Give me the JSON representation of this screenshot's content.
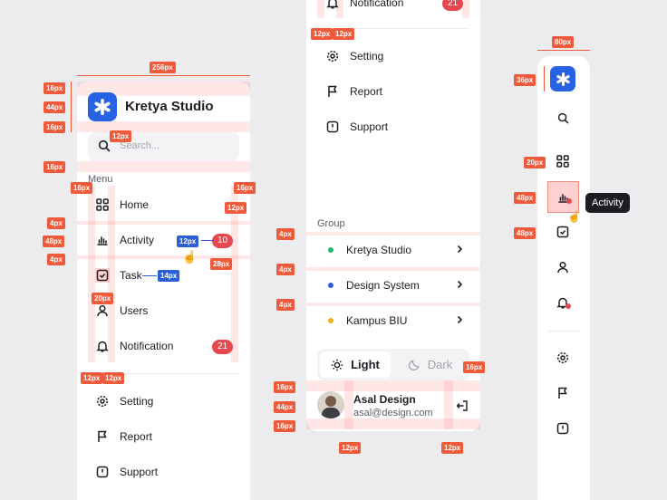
{
  "brand": {
    "name": "Kretya Studio"
  },
  "search": {
    "placeholder": "Search..."
  },
  "menu": {
    "heading": "Menu",
    "items": [
      {
        "label": "Home",
        "icon": "grid-icon"
      },
      {
        "label": "Activity",
        "icon": "chart-bars-icon"
      },
      {
        "label": "Task",
        "icon": "checkbox-icon"
      },
      {
        "label": "Users",
        "icon": "user-icon"
      },
      {
        "label": "Notification",
        "icon": "bell-icon",
        "badge": "21"
      }
    ],
    "activity_badge": "10"
  },
  "footer_items": [
    {
      "label": "Setting",
      "icon": "gear-icon"
    },
    {
      "label": "Report",
      "icon": "flag-icon"
    },
    {
      "label": "Support",
      "icon": "alert-square-icon"
    }
  ],
  "panel2": {
    "notification": {
      "label": "Notification",
      "badge": "21"
    },
    "group_heading": "Group",
    "groups": [
      {
        "label": "Kretya Studio",
        "color": "#22b573"
      },
      {
        "label": "Design System",
        "color": "#2c5fd6"
      },
      {
        "label": "Kampus BIU",
        "color": "#f2b01e"
      }
    ],
    "theme": {
      "light": "Light",
      "dark": "Dark",
      "selected": "Light"
    },
    "user": {
      "name": "Asal Design",
      "email": "asal@design.com"
    }
  },
  "panel3": {
    "tooltip": "Activity"
  },
  "spec_tags": {
    "w256": "256px",
    "h16a": "16px",
    "h44": "44px",
    "h16b": "16px",
    "g12": "12px",
    "h16c": "16px",
    "l16": "16px",
    "r16": "16px",
    "r12": "12px",
    "v4a": "4px",
    "v48": "48px",
    "v4b": "4px",
    "b12": "12px",
    "b28": "28px",
    "b14": "14px",
    "i20": "20px",
    "bl12": "12px",
    "br12": "12px",
    "p2t12a": "12px",
    "p2t12b": "12px",
    "p2v4a": "4px",
    "p2v4b": "4px",
    "p2v4c": "4px",
    "p2r16": "16px",
    "p2h16a": "16px",
    "p2h44": "44px",
    "p2h16b": "16px",
    "p2bl12": "12px",
    "p2br12": "12px",
    "p3w80": "80px",
    "p3h36": "36px",
    "p3i20": "20px",
    "p3v48a": "48px",
    "p3v48b": "48px"
  },
  "colors": {
    "accent": "#2563e4",
    "badge": "#e5484d",
    "spec": "#ee5a3a"
  }
}
